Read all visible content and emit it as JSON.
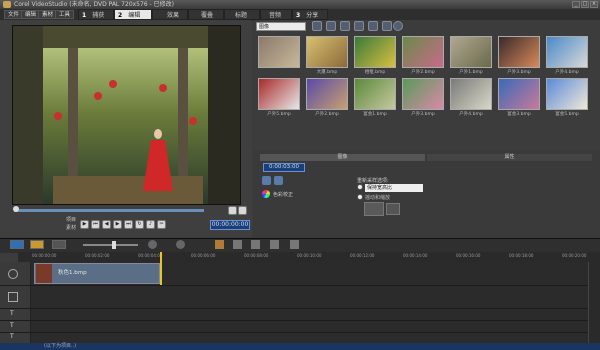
{
  "window": {
    "title": "Corel VideoStudio (未命名, DVD PAL 720x576 - 已修改)",
    "controls": [
      "_",
      "□",
      "×"
    ]
  },
  "menu": {
    "items": [
      "文件",
      "编辑",
      "素材",
      "工具"
    ]
  },
  "steps": {
    "tabs": [
      {
        "num": "1",
        "label": "捕获"
      },
      {
        "num": "2",
        "label": "编辑"
      },
      {
        "num": "",
        "label": "效果"
      },
      {
        "num": "",
        "label": "覆叠"
      },
      {
        "num": "",
        "label": "标题"
      },
      {
        "num": "",
        "label": "音频"
      },
      {
        "num": "3",
        "label": "分享"
      }
    ]
  },
  "preview": {
    "timecode": "00:00:00:00",
    "project_label": "项目",
    "clip_label": "素材"
  },
  "library": {
    "category": "图像",
    "thumbnails": [
      {
        "label": "",
        "colors": [
          "#8a7a6a",
          "#c8b89a"
        ]
      },
      {
        "label": "大厦.bmp",
        "colors": [
          "#d8c070",
          "#8a6a3a"
        ]
      },
      {
        "label": "相框.bmp",
        "colors": [
          "#3a7a3a",
          "#d8c040"
        ]
      },
      {
        "label": "户外2.bmp",
        "colors": [
          "#6a8a4a",
          "#c86a8a"
        ]
      },
      {
        "label": "户外1.bmp",
        "colors": [
          "#b0a890",
          "#6a6a4a"
        ]
      },
      {
        "label": "户外3.bmp",
        "colors": [
          "#3a2a2a",
          "#d88a5a"
        ]
      },
      {
        "label": "户外4.bmp",
        "colors": [
          "#4a8ac8",
          "#d8d8d8"
        ]
      },
      {
        "label": "户外5.bmp",
        "colors": [
          "#a82a2a",
          "#e8e8e8"
        ]
      },
      {
        "label": "户外2.bmp",
        "colors": [
          "#5a4aa8",
          "#c8a070"
        ]
      },
      {
        "label": "宴会1.bmp",
        "colors": [
          "#5a8a3a",
          "#c8c8a0"
        ]
      },
      {
        "label": "户外3.bmp",
        "colors": [
          "#5a9a5a",
          "#d88aa8"
        ]
      },
      {
        "label": "户外4.bmp",
        "colors": [
          "#7a7a7a",
          "#d8d8c8"
        ]
      },
      {
        "label": "宴会3.bmp",
        "colors": [
          "#3a6ab8",
          "#c87a9a"
        ]
      },
      {
        "label": "宴会5.bmp",
        "colors": [
          "#5a8ad8",
          "#f0e8d8"
        ]
      }
    ]
  },
  "options": {
    "tabs": [
      "图像",
      "属性"
    ],
    "duration": "0:00:03:00",
    "resample_label": "重新采样选项:",
    "resample_value": "保持宽高比",
    "pan_zoom_label": "摇动和缩放",
    "color_correction_label": "色彩校正"
  },
  "timeline": {
    "ruler": [
      "00:00:00:00",
      "00:00:02:00",
      "00:00:04:00",
      "00:00:06:00",
      "00:00:08:00",
      "00:00:10:00",
      "00:00:12:00",
      "00:00:14:00",
      "00:00:16:00",
      "00:00:18:00",
      "00:00:20:00"
    ],
    "clip_name": "秋色1.bmp",
    "track_labels": [
      "T",
      "T",
      "T"
    ]
  },
  "status": {
    "text": "(以下为项目..)"
  },
  "colors": {
    "playhead": "#e8c42a",
    "timecode_bg": "#1b3f7a"
  }
}
